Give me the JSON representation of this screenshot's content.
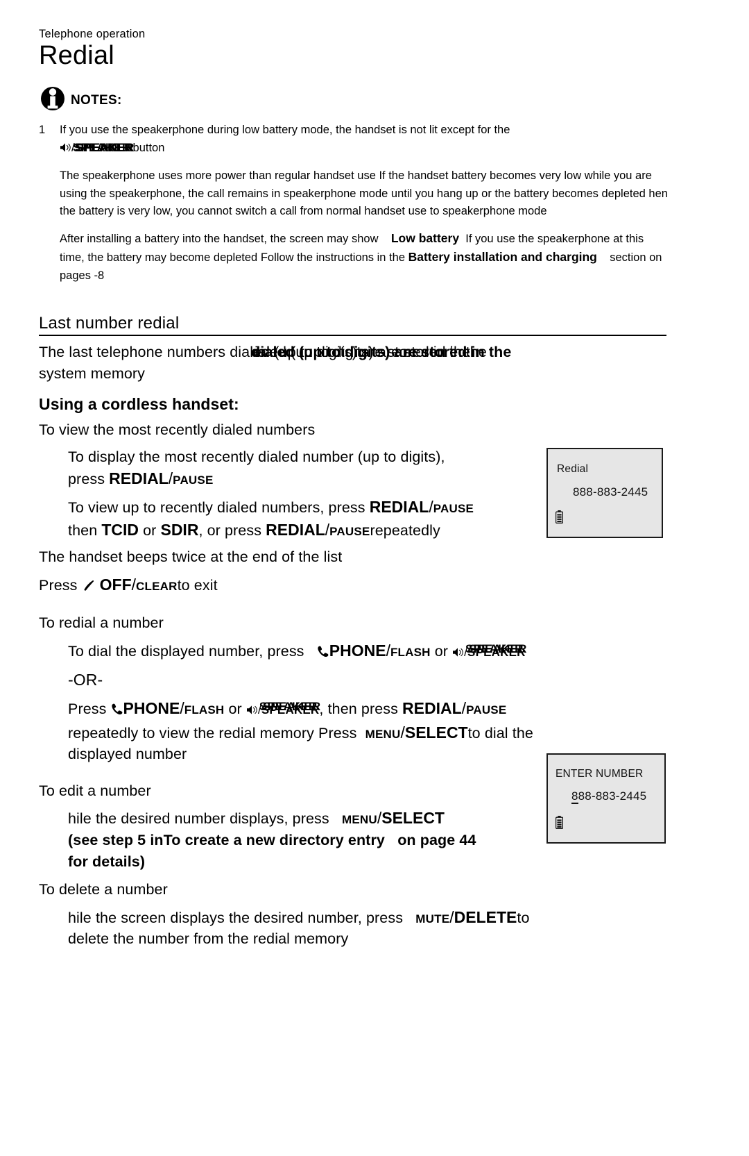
{
  "page": {
    "running_head": "Telephone operation",
    "chapter_title": "Redial"
  },
  "notes": {
    "icon": "info-circle-icon",
    "label": "NOTES:",
    "items": [
      {
        "number": "1",
        "line1_text": "If you use the speakerphone during low battery mode, the handset is not lit except for the",
        "line2_icon": "speaker-icon",
        "line2_slash": "/",
        "line2_key": "SPEAKER",
        "line2_tail": "button"
      }
    ],
    "paragraphs": [
      "The speakerphone uses more power than    regular handset use   If the handset battery becomes very low while you are using the speakerphone, the call remains in speakerphone mode until you hang up or the battery becomes depleted hen the battery is very low, you cannot switch a call from normal handset use to speakerphone mode",
      "After installing a battery into the handset, the screen may show"
    ],
    "low_battery_screen": "Low battery",
    "after_low_battery": "If you use the speakerphone at this time, the battery may become depleted Follow the instructions in the",
    "battery_section_ref": "Battery installation and charging",
    "battery_section_tail": "section on  pages   -8"
  },
  "last_number_redial": {
    "heading": "Last number redial",
    "intro_a": "The last  telephone numbers dial",
    "intro_overlap_1": "ed (up to  digits) are stored in the",
    "intro_overlap_2": "ialed (up to digits) are stored in the",
    "intro_overlap_3": "dialed (up to digits) are stored in the",
    "intro_line2": "system memory",
    "using_handset_heading": "Using a cordless handset:",
    "to_view_heading": "To view the  most recently dialed numbers",
    "display_recent_a": "To display the most recently    dialed number (up to        digits),",
    "display_recent_b_press": "press",
    "key_redial": "REDIAL",
    "key_slash": "/",
    "key_pause": "PAUSE",
    "view_up_to_a": "To view up to        recently  dialed numbers, press",
    "view_up_to_then": "then",
    "key_tcid": "TCID",
    "or_word": "or",
    "key_sdir": "SDIR",
    "view_up_to_tail": ", or press",
    "repeatedly": "repeatedly",
    "beeps_twice": "The handset beeps twice at the end of the list",
    "press_word": "Press",
    "off_icon": "phone-off-icon",
    "key_off": "OFF",
    "key_clear": "CLEAR",
    "to_exit": "to exit"
  },
  "to_redial": {
    "heading": "To redial a number",
    "dial_displayed_a": "To dial the displayed number, press",
    "phone_icon": "phone-handset-icon",
    "key_phone": "PHONE",
    "key_flash": "FLASH",
    "or_word": "or",
    "speaker_icon": "speaker-icon",
    "key_speaker": "SPEAKER",
    "or_divider": "-OR-",
    "press_word": "Press",
    "then_press": ", then  press",
    "key_redial": "REDIAL",
    "key_pause": "PAUSE",
    "repeatedly_view": "repeatedly to  view the redial memory Press",
    "key_menu": "MENU",
    "key_select": "SELECT",
    "to_dial_tail": "to dial the",
    "displayed_number": "displayed number"
  },
  "to_edit": {
    "heading": "To edit a number",
    "line_a": "hile the desired number displays, press",
    "key_menu": "MENU",
    "key_select": "SELECT",
    "line_b": "(see step 5 in",
    "line_b_ref": "To create a new directory entry",
    "line_b_tail": "on page 44",
    "line_c": "for details)"
  },
  "to_delete": {
    "heading": "To delete a number",
    "line_a": "hile the screen displays the desired number, press",
    "key_mute": "MUTE",
    "key_slash": "/",
    "key_delete": "DELETE",
    "line_a_tail": "to",
    "line_b": "delete the number from the redial memory"
  },
  "lcd_screens": [
    {
      "name": "redial-screen",
      "title": "Redial",
      "number": "888-883-2445",
      "battery_icon": "battery-icon"
    },
    {
      "name": "enter-number-screen",
      "title": "ENTER NUMBER",
      "number_cursor": "8",
      "number_rest": "88-883-2445",
      "battery_icon": "battery-icon"
    }
  ],
  "colors": {
    "lcd_background": "#e6e6e6",
    "lcd_border": "#1a1a1a",
    "text": "#000000"
  }
}
